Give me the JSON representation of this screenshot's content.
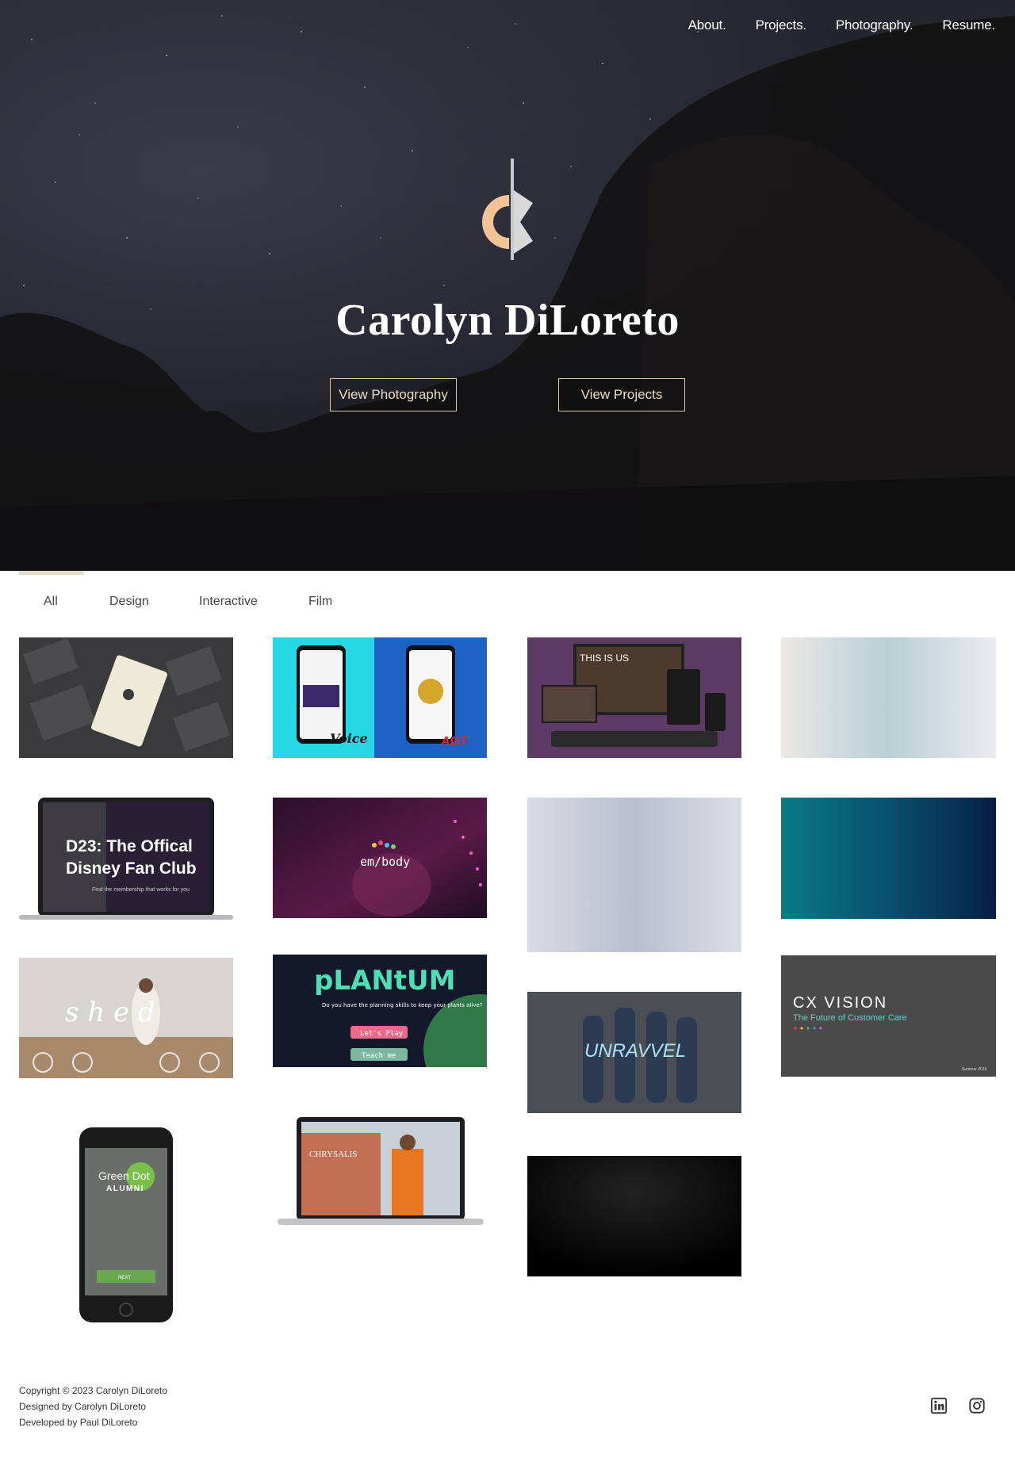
{
  "nav": {
    "items": [
      {
        "label": "About."
      },
      {
        "label": "Projects."
      },
      {
        "label": "Photography."
      },
      {
        "label": "Resume."
      }
    ]
  },
  "hero": {
    "name": "Carolyn DiLoreto",
    "btn_photography": "View Photography",
    "btn_projects": "View Projects"
  },
  "filters": {
    "all": "All",
    "design": "Design",
    "interactive": "Interactive",
    "film": "Film"
  },
  "projects": {
    "d23_title_line1": "D23: The Offical",
    "d23_title_line2": "Disney Fan Club",
    "d23_sub": "Find the membership that works for you",
    "embody": "em/body",
    "shed": "s h e d",
    "plantum_title": "pLANtUM",
    "plantum_q": "Do you have the planning skills to keep your plants alive?",
    "plantum_btn1": "Let's Play",
    "plantum_btn2": "Teach me",
    "unravvel": "UNRAVVEL",
    "cx_title": "CX VISION",
    "cx_sub": "The Future of Customer Care",
    "cx_foot": "Summer 2016",
    "greendot_line1": "Green Dot",
    "greendot_line2": "ALUMNI",
    "greendot_next": "NEXT",
    "chrysalis": "CHRYSALIS",
    "thisisus": "THIS IS US",
    "voice": "Voice",
    "agt": "AGT"
  },
  "footer": {
    "copyright": "Copyright © 2023 Carolyn DiLoreto",
    "designed": "Designed by Carolyn DiLoreto",
    "developed": "Developed by Paul DiLoreto"
  },
  "icons": {
    "linkedin": "linkedin-icon",
    "instagram": "instagram-icon"
  },
  "colors": {
    "accent": "#e8dcc6",
    "logo_peach": "#f3c295"
  }
}
